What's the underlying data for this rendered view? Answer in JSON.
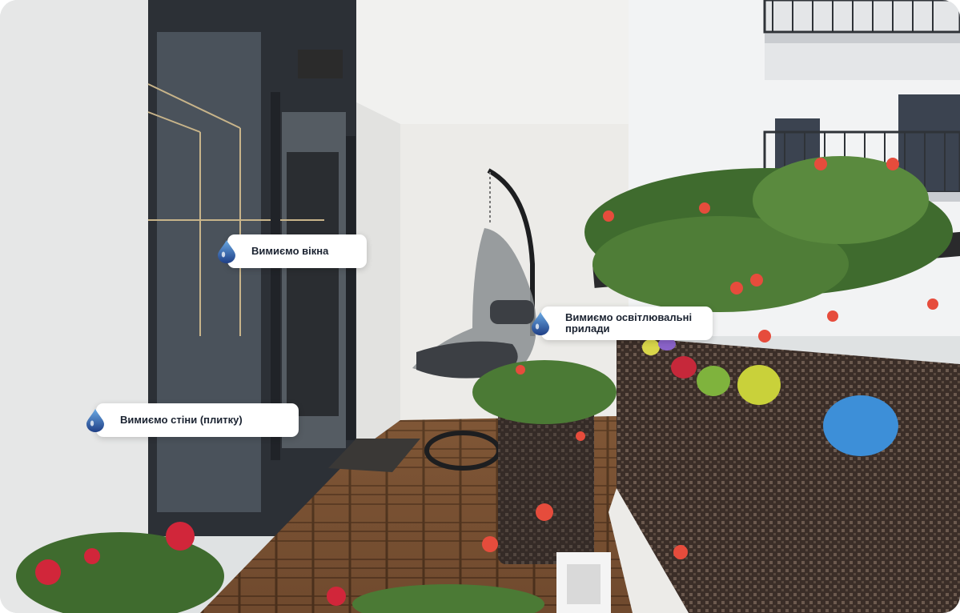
{
  "hotspots": [
    {
      "label": "Вимиємо вікна",
      "icon": "water-drop-icon"
    },
    {
      "label": "Вимиємо освітлювальні прилади",
      "icon": "water-drop-icon"
    },
    {
      "label": "Вимиємо стіни (плитку)",
      "icon": "water-drop-icon"
    }
  ],
  "colors": {
    "drop_gradient_start": "#6aa9e3",
    "drop_gradient_end": "#1f3f86",
    "label_text": "#1a2230"
  }
}
